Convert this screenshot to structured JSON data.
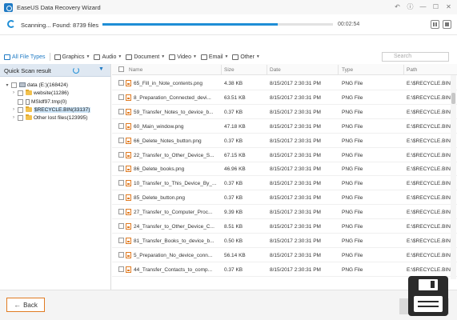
{
  "window": {
    "title": "EaseUS Data Recovery Wizard"
  },
  "scan": {
    "status_text": "Scanning... Found: 8739 files",
    "elapsed": "00:02:54",
    "progress_fraction": 0.76
  },
  "file_types": {
    "items": [
      {
        "label": "All File Types",
        "icon": "all-types-icon",
        "dropdown": false
      },
      {
        "label": "Graphics",
        "icon": "graphics-icon",
        "dropdown": true
      },
      {
        "label": "Audio",
        "icon": "audio-icon",
        "dropdown": true
      },
      {
        "label": "Document",
        "icon": "document-icon",
        "dropdown": true
      },
      {
        "label": "Video",
        "icon": "video-icon",
        "dropdown": true
      },
      {
        "label": "Email",
        "icon": "email-icon",
        "dropdown": true
      },
      {
        "label": "Other",
        "icon": "other-icon",
        "dropdown": true
      }
    ],
    "search_placeholder": "Search"
  },
  "quick_scan": {
    "title": "Quick Scan result",
    "tree": [
      {
        "label": "data (E:)(168424)",
        "level": 0,
        "expander": "▾",
        "icon": "drive"
      },
      {
        "label": "website(11286)",
        "level": 1,
        "expander": "›",
        "icon": "folder"
      },
      {
        "label": "MSldf97.tmp(0)",
        "level": 1,
        "expander": "",
        "icon": "file"
      },
      {
        "label": "$RECYCLE.BIN(33137)",
        "level": 1,
        "expander": "›",
        "icon": "folder",
        "selected": true
      },
      {
        "label": "Other lost files(123995)",
        "level": 1,
        "expander": "›",
        "icon": "folder"
      }
    ]
  },
  "file_list": {
    "columns": [
      "Name",
      "Size",
      "Date",
      "Type",
      "Path"
    ],
    "rows": [
      {
        "name": "65_Fill_in_Note_contents.png",
        "size": "4.38 KB",
        "date": "8/15/2017 2:30:31 PM",
        "type": "PNG File",
        "path": "E:\\$RECYCLE.BIN"
      },
      {
        "name": "8_Preparation_Connected_devi...",
        "size": "63.51 KB",
        "date": "8/15/2017 2:30:31 PM",
        "type": "PNG File",
        "path": "E:\\$RECYCLE.BIN"
      },
      {
        "name": "59_Transfer_Notes_to_device_b...",
        "size": "0.37 KB",
        "date": "8/15/2017 2:30:31 PM",
        "type": "PNG File",
        "path": "E:\\$RECYCLE.BIN"
      },
      {
        "name": "60_Main_window.png",
        "size": "47.18 KB",
        "date": "8/15/2017 2:30:31 PM",
        "type": "PNG File",
        "path": "E:\\$RECYCLE.BIN"
      },
      {
        "name": "66_Delete_Notes_button.png",
        "size": "0.37 KB",
        "date": "8/15/2017 2:30:31 PM",
        "type": "PNG File",
        "path": "E:\\$RECYCLE.BIN"
      },
      {
        "name": "22_Transfer_to_Other_Device_S...",
        "size": "67.15 KB",
        "date": "8/15/2017 2:30:31 PM",
        "type": "PNG File",
        "path": "E:\\$RECYCLE.BIN"
      },
      {
        "name": "86_Delete_books.png",
        "size": "46.96 KB",
        "date": "8/15/2017 2:30:31 PM",
        "type": "PNG File",
        "path": "E:\\$RECYCLE.BIN"
      },
      {
        "name": "10_Transfer_to_This_Device_By_...",
        "size": "0.37 KB",
        "date": "8/15/2017 2:30:31 PM",
        "type": "PNG File",
        "path": "E:\\$RECYCLE.BIN"
      },
      {
        "name": "85_Delete_button.png",
        "size": "0.37 KB",
        "date": "8/15/2017 2:30:31 PM",
        "type": "PNG File",
        "path": "E:\\$RECYCLE.BIN"
      },
      {
        "name": "27_Transfer_to_Computer_Proc...",
        "size": "9.39 KB",
        "date": "8/15/2017 2:30:31 PM",
        "type": "PNG File",
        "path": "E:\\$RECYCLE.BIN"
      },
      {
        "name": "24_Transfer_to_Other_Device_C...",
        "size": "8.51 KB",
        "date": "8/15/2017 2:30:31 PM",
        "type": "PNG File",
        "path": "E:\\$RECYCLE.BIN"
      },
      {
        "name": "81_Transfer_Books_to_device_b...",
        "size": "0.50 KB",
        "date": "8/15/2017 2:30:31 PM",
        "type": "PNG File",
        "path": "E:\\$RECYCLE.BIN"
      },
      {
        "name": "5_Preparation_No_device_conn...",
        "size": "56.14 KB",
        "date": "8/15/2017 2:30:31 PM",
        "type": "PNG File",
        "path": "E:\\$RECYCLE.BIN"
      },
      {
        "name": "44_Transfer_Contacts_to_comp...",
        "size": "0.37 KB",
        "date": "8/15/2017 2:30:31 PM",
        "type": "PNG File",
        "path": "E:\\$RECYCLE.BIN"
      }
    ]
  },
  "footer": {
    "back_label": "Back"
  }
}
